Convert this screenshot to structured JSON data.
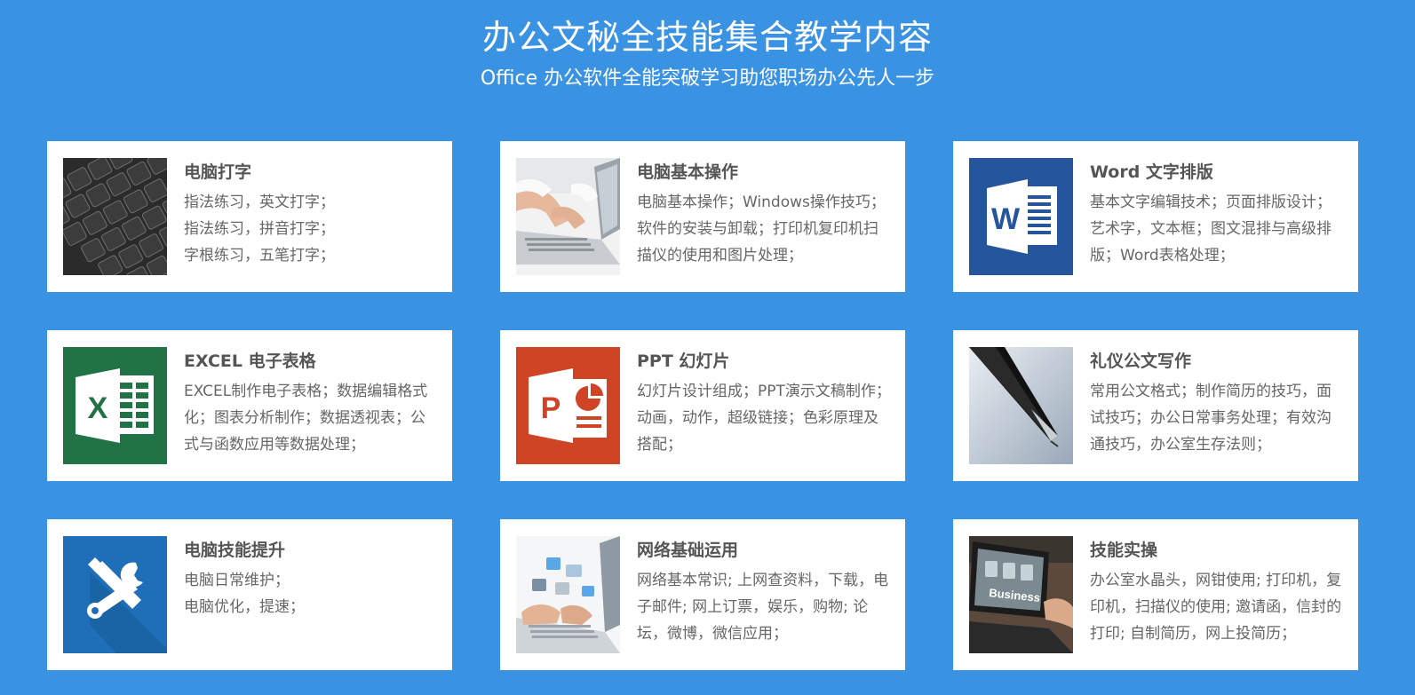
{
  "header": {
    "title": "办公文秘全技能集合教学内容",
    "subtitle": "Office 办公软件全能突破学习助您职场办公先人一步"
  },
  "cards": [
    {
      "title": "电脑打字",
      "desc": "指法练习，英文打字；\n指法练习，拼音打字；\n字根练习，五笔打字；",
      "icon": "keyboard-photo"
    },
    {
      "title": "电脑基本操作",
      "desc": "电脑基本操作；Windows操作技巧；软件的安装与卸载；打印机复印机扫描仪的使用和图片处理；",
      "icon": "laptop-typing-photo"
    },
    {
      "title": "Word 文字排版",
      "desc": "基本文字编辑技术；页面排版设计；艺术字，文本框；图文混排与高级排版；Word表格处理；",
      "icon": "word-icon"
    },
    {
      "title": "EXCEL 电子表格",
      "desc": "EXCEL制作电子表格；数据编辑格式化；图表分析制作；数据透视表；公式与函数应用等数据处理；",
      "icon": "excel-icon"
    },
    {
      "title": "PPT 幻灯片",
      "desc": "幻灯片设计组成；PPT演示文稿制作；动画，动作，超级链接；色彩原理及搭配；",
      "icon": "powerpoint-icon"
    },
    {
      "title": "礼仪公文写作",
      "desc": "常用公文格式；制作简历的技巧，面试技巧；办公日常事务处理；有效沟通技巧，办公室生存法则；",
      "icon": "fountain-pen-photo"
    },
    {
      "title": "电脑技能提升",
      "desc": "电脑日常维护；\n电脑优化，提速；",
      "icon": "tools-icon"
    },
    {
      "title": "网络基础运用",
      "desc": "网络基本常识; 上网查资料，下载，电子邮件; 网上订票，娱乐，购物; 论坛，微博，微信应用；",
      "icon": "network-laptop-photo"
    },
    {
      "title": "技能实操",
      "desc": "办公室水晶头，网钳使用; 打印机，复印机，扫描仪的使用; 邀请函，信封的打印; 自制简历，网上投简历；",
      "icon": "business-laptop-photo",
      "image_text": "Business"
    }
  ]
}
